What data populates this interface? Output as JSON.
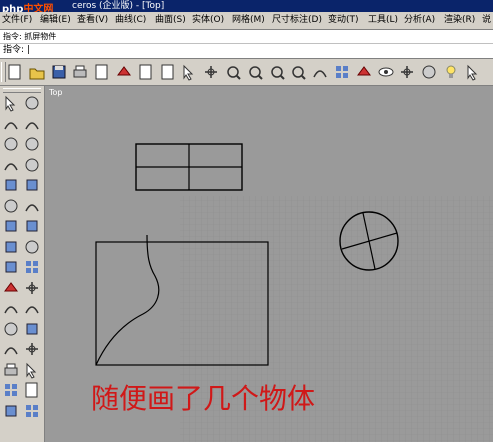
{
  "titlebar": {
    "logo_main": "php",
    "logo_site": "中文网",
    "title": "ceros (企业版) - [Top]"
  },
  "menu": {
    "items": [
      "文件(F)",
      "编辑(E)",
      "查看(V)",
      "曲线(C)",
      "曲面(S)",
      "实体(O)",
      "网格(M)",
      "尺寸标注(D)",
      "变动(T)",
      "工具(L)",
      "分析(A)",
      "渲染(R)",
      "说"
    ]
  },
  "command": {
    "history": "指令: 抓屏物件",
    "prompt": "指令: "
  },
  "toolbar": {
    "icons": [
      "new-file-icon",
      "open-folder-icon",
      "save-icon",
      "print-icon",
      "copy-doc-icon",
      "cut-icon",
      "copy-icon",
      "paste-icon",
      "pan-hand-icon",
      "move-view-icon",
      "zoom-icon",
      "zoom-window-icon",
      "zoom-extents-icon",
      "zoom-selected-icon",
      "rotate-view-icon",
      "four-viewports-icon",
      "car-icon",
      "eye-icon",
      "camera-icon",
      "target-icon",
      "light-bulb-icon",
      "help-icon"
    ]
  },
  "sidebar": {
    "icons": [
      "select-arrow-icon",
      "point-icon",
      "polyline-icon",
      "curve-icon",
      "circle-icon",
      "circle-3pt-icon",
      "arc-icon",
      "ellipse-icon",
      "polygon-icon",
      "rectangle-icon",
      "circle-target-icon",
      "fillet-icon",
      "surface-patch-icon",
      "surface-edge-icon",
      "cylinder-icon",
      "sphere-icon",
      "box-icon",
      "mesh-icon",
      "extrude-icon",
      "explode-icon",
      "trim-icon",
      "split-icon",
      "shade-icon",
      "boolean-icon",
      "offset-icon",
      "move-icon",
      "dimension-icon",
      "transform-icon",
      "grid-icon",
      "text-icon",
      "box-solid-icon",
      "misc-icon"
    ]
  },
  "viewport": {
    "name": "Top"
  },
  "annotation": {
    "caption": "随便画了几个物体"
  }
}
